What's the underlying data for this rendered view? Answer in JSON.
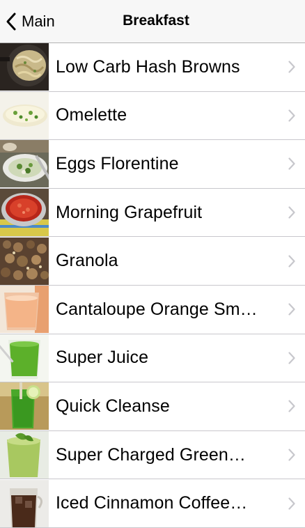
{
  "navbar": {
    "back_label": "Main",
    "title": "Breakfast"
  },
  "items": [
    {
      "label": "Low Carb Hash Browns",
      "thumb": "hash-browns-image"
    },
    {
      "label": "Omelette",
      "thumb": "omelette-image"
    },
    {
      "label": "Eggs Florentine",
      "thumb": "eggs-florentine-image"
    },
    {
      "label": "Morning Grapefruit",
      "thumb": "grapefruit-image"
    },
    {
      "label": "Granola",
      "thumb": "granola-image"
    },
    {
      "label": "Cantaloupe Orange Sm…",
      "thumb": "smoothie-image"
    },
    {
      "label": "Super Juice",
      "thumb": "green-juice-image"
    },
    {
      "label": "Quick Cleanse",
      "thumb": "cleanse-drink-image"
    },
    {
      "label": "Super Charged Green…",
      "thumb": "green-smoothie-image"
    },
    {
      "label": "Iced Cinnamon Coffee…",
      "thumb": "iced-coffee-image"
    }
  ],
  "colors": {
    "navbar_bg": "#f7f7f7",
    "separator": "#c8c7cc",
    "chevron": "#c7c7cc"
  }
}
